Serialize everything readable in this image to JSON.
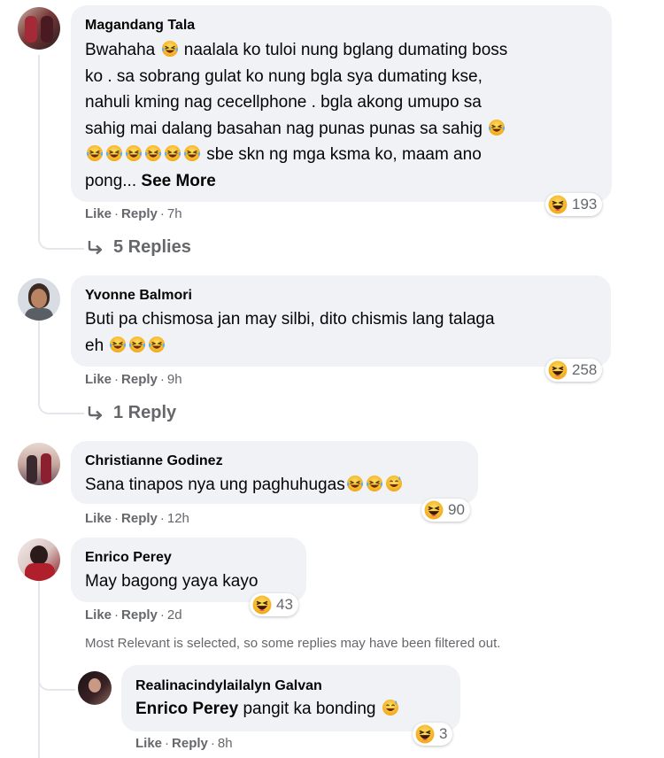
{
  "comments": [
    {
      "author": "Magandang Tala",
      "lines": [
        [
          "Bwahaha ",
          "laugh",
          " naalala ko tuloi nung bglang dumating boss"
        ],
        [
          "ko . sa sobrang gulat ko nung bgla sya dumating kse,"
        ],
        [
          "nahuli kming nag cecellphone . bgla akong umupo sa"
        ],
        [
          "sahig mai dalang basahan nag punas punas sa sahig ",
          "laugh"
        ],
        [
          "laugh",
          "laugh",
          "laugh",
          "laugh",
          "laugh",
          "laugh",
          " sbe skn ng mga ksma ko, maam ano"
        ]
      ],
      "last_line_prefix": "pong... ",
      "see_more": "See More",
      "like": "Like",
      "reply": "Reply",
      "time": "7h",
      "reaction_count": "193",
      "replies_link": "5 Replies"
    },
    {
      "author": "Yvonne Balmori",
      "line1": "Buti pa chismosa jan may silbi, dito chismis lang talaga",
      "line2": "eh",
      "like": "Like",
      "reply": "Reply",
      "time": "9h",
      "reaction_count": "258",
      "replies_link": "1 Reply"
    },
    {
      "author": "Christianne Godinez",
      "text": "Sana tinapos nya ung paghuhugas",
      "like": "Like",
      "reply": "Reply",
      "time": "12h",
      "reaction_count": "90"
    },
    {
      "author": "Enrico Perey",
      "text": "May bagong yaya kayo",
      "like": "Like",
      "reply": "Reply",
      "time": "2d",
      "reaction_count": "43"
    }
  ],
  "filter_note": "Most Relevant is selected, so some replies may have been filtered out.",
  "reply": {
    "author": "Realinacindylailalyn Galvan",
    "mention": "Enrico Perey",
    "text": " pangit ka bonding",
    "like": "Like",
    "reply": "Reply",
    "time": "8h",
    "reaction_count": "3"
  },
  "colors": {
    "bubble": "#f0f2f5",
    "meta": "#65676b",
    "emoji_yellow": "#f7b125"
  }
}
